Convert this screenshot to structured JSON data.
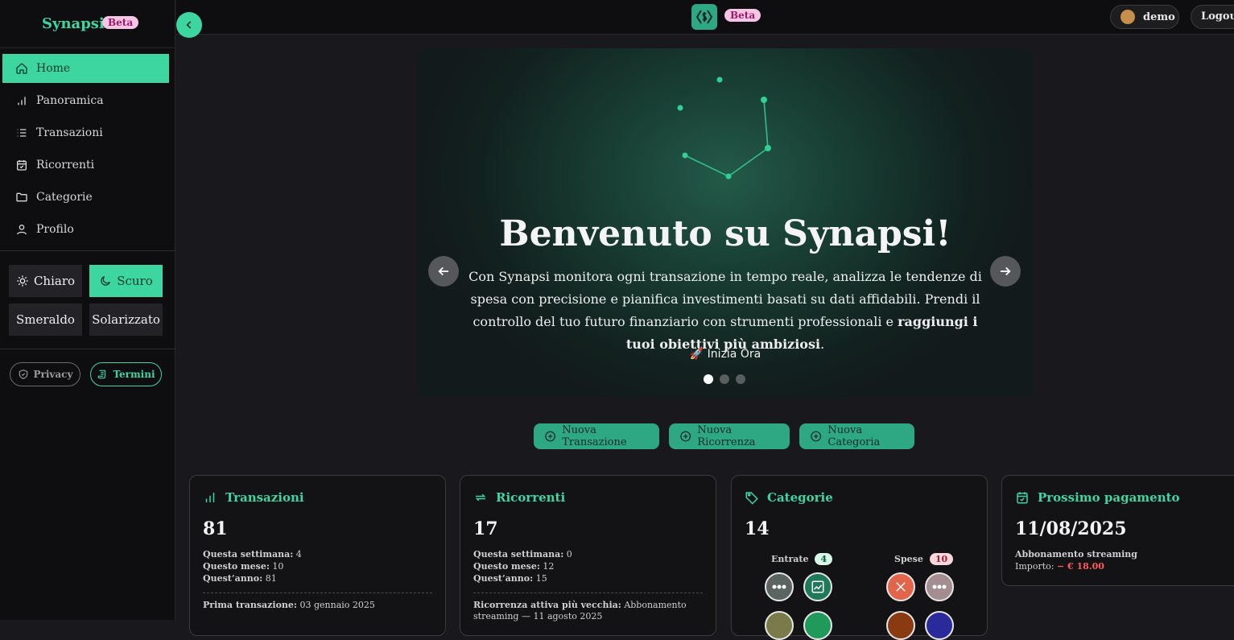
{
  "brand": {
    "name": "Synapsi",
    "badge": "Beta"
  },
  "sidebar": {
    "items": [
      {
        "label": "Home",
        "icon": "home-icon",
        "active": true
      },
      {
        "label": "Panoramica",
        "icon": "bar-chart-icon",
        "active": false
      },
      {
        "label": "Transazioni",
        "icon": "list-icon",
        "active": false
      },
      {
        "label": "Ricorrenti",
        "icon": "calendar-check-icon",
        "active": false
      },
      {
        "label": "Categorie",
        "icon": "folder-icon",
        "active": false
      },
      {
        "label": "Profilo",
        "icon": "user-icon",
        "active": false
      }
    ],
    "themes": {
      "light": "Chiaro",
      "dark": "Scuro",
      "emerald": "Smeraldo",
      "solarized": "Solarizzato"
    },
    "links": {
      "privacy": "Privacy",
      "terms": "Termini"
    }
  },
  "topbar": {
    "badge": "Beta",
    "user": "demo",
    "logout": "Logout"
  },
  "hero": {
    "title": "Benvenuto su Synapsi!",
    "text_plain": "Con Synapsi monitora ogni transazione in tempo reale, analizza le tendenze di spesa con precisione e pianifica investimenti basati su dati affidabili. Prendi il controllo del tuo futuro finanziario con strumenti professionali e ",
    "text_bold": "raggiungi i tuoi obiettivi più ambiziosi",
    "text_end": ".",
    "cta": "🚀 Inizia Ora",
    "slides": 3,
    "active_slide": 1
  },
  "actions": [
    "Nuova Transazione",
    "Nuova Ricorrenza",
    "Nuova Categoria"
  ],
  "cards": {
    "transactions": {
      "title": "Transazioni",
      "count": "81",
      "week_label": "Questa settimana:",
      "week": "4",
      "month_label": "Questo mese:",
      "month": "10",
      "year_label": "Quest’anno:",
      "year": "81",
      "first_label": "Prima transazione:",
      "first": "03 gennaio 2025"
    },
    "recurring": {
      "title": "Ricorrenti",
      "count": "17",
      "week_label": "Questa settimana:",
      "week": "0",
      "month_label": "Questo mese:",
      "month": "12",
      "year_label": "Quest’anno:",
      "year": "15",
      "oldest_label": "Ricorrenza attiva più vecchia:",
      "oldest": "Abbonamento streaming — 11 agosto 2025"
    },
    "categories": {
      "title": "Categorie",
      "count": "14",
      "income_label": "Entrate",
      "income_count": "4",
      "expense_label": "Spese",
      "expense_count": "10"
    },
    "next_payment": {
      "title": "Prossimo pagamento",
      "date": "11/08/2025",
      "name": "Abbonamento streaming",
      "amount_label": "Importo:",
      "amount": "− € 18.00"
    }
  },
  "colors": {
    "accent": "#3dd6a0",
    "action": "#2ea783",
    "negative": "#ff5a5a"
  }
}
